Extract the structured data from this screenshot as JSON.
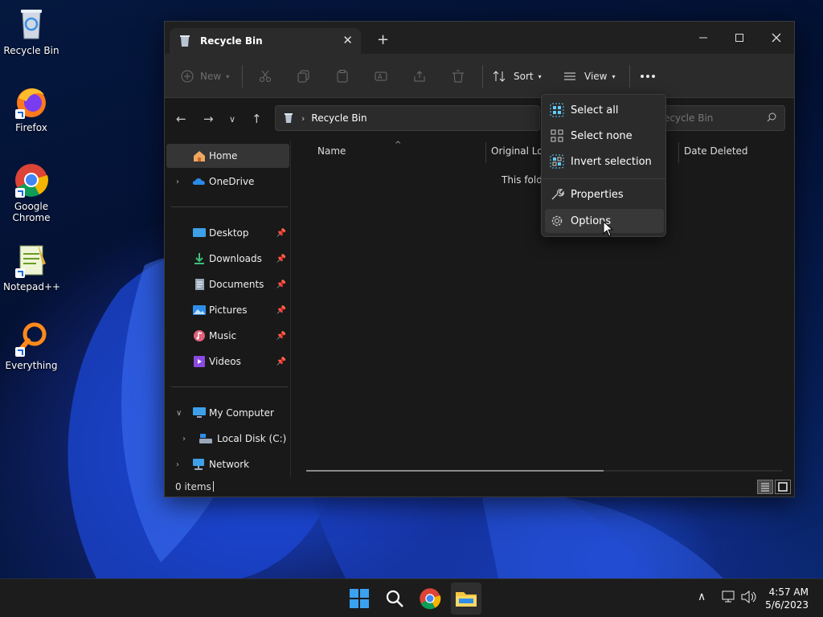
{
  "desktop": {
    "icons": [
      {
        "label": "Recycle Bin"
      },
      {
        "label": "Firefox"
      },
      {
        "label": "Google Chrome"
      },
      {
        "label": "Notepad++"
      },
      {
        "label": "Everything"
      }
    ]
  },
  "window": {
    "tab_title": "Recycle Bin",
    "toolbar": {
      "new_label": "New",
      "sort_label": "Sort",
      "view_label": "View"
    },
    "address": {
      "location": "Recycle Bin"
    },
    "search": {
      "placeholder": "Search Recycle Bin",
      "visible_text": "ecycle Bin"
    },
    "sidebar": {
      "home": "Home",
      "onedrive": "OneDrive",
      "quick_access": [
        {
          "label": "Desktop"
        },
        {
          "label": "Downloads"
        },
        {
          "label": "Documents"
        },
        {
          "label": "Pictures"
        },
        {
          "label": "Music"
        },
        {
          "label": "Videos"
        }
      ],
      "my_computer": "My Computer",
      "local_disk": "Local Disk (C:)",
      "network": "Network"
    },
    "columns": {
      "name": "Name",
      "original_location": "Original Loc",
      "date_deleted": "Date Deleted"
    },
    "empty_message": "This folde",
    "status": {
      "item_count": "0 items"
    },
    "menu": {
      "items": [
        {
          "label": "Select all"
        },
        {
          "label": "Select none"
        },
        {
          "label": "Invert selection"
        },
        {
          "label": "Properties"
        },
        {
          "label": "Options"
        }
      ]
    }
  },
  "taskbar": {
    "time": "4:57 AM",
    "date": "5/6/2023"
  },
  "colors": {
    "accent": "#60cdff",
    "window_bg": "#191919",
    "toolbar_bg": "#2b2b2b",
    "folder_yellow": "#f4c542"
  }
}
